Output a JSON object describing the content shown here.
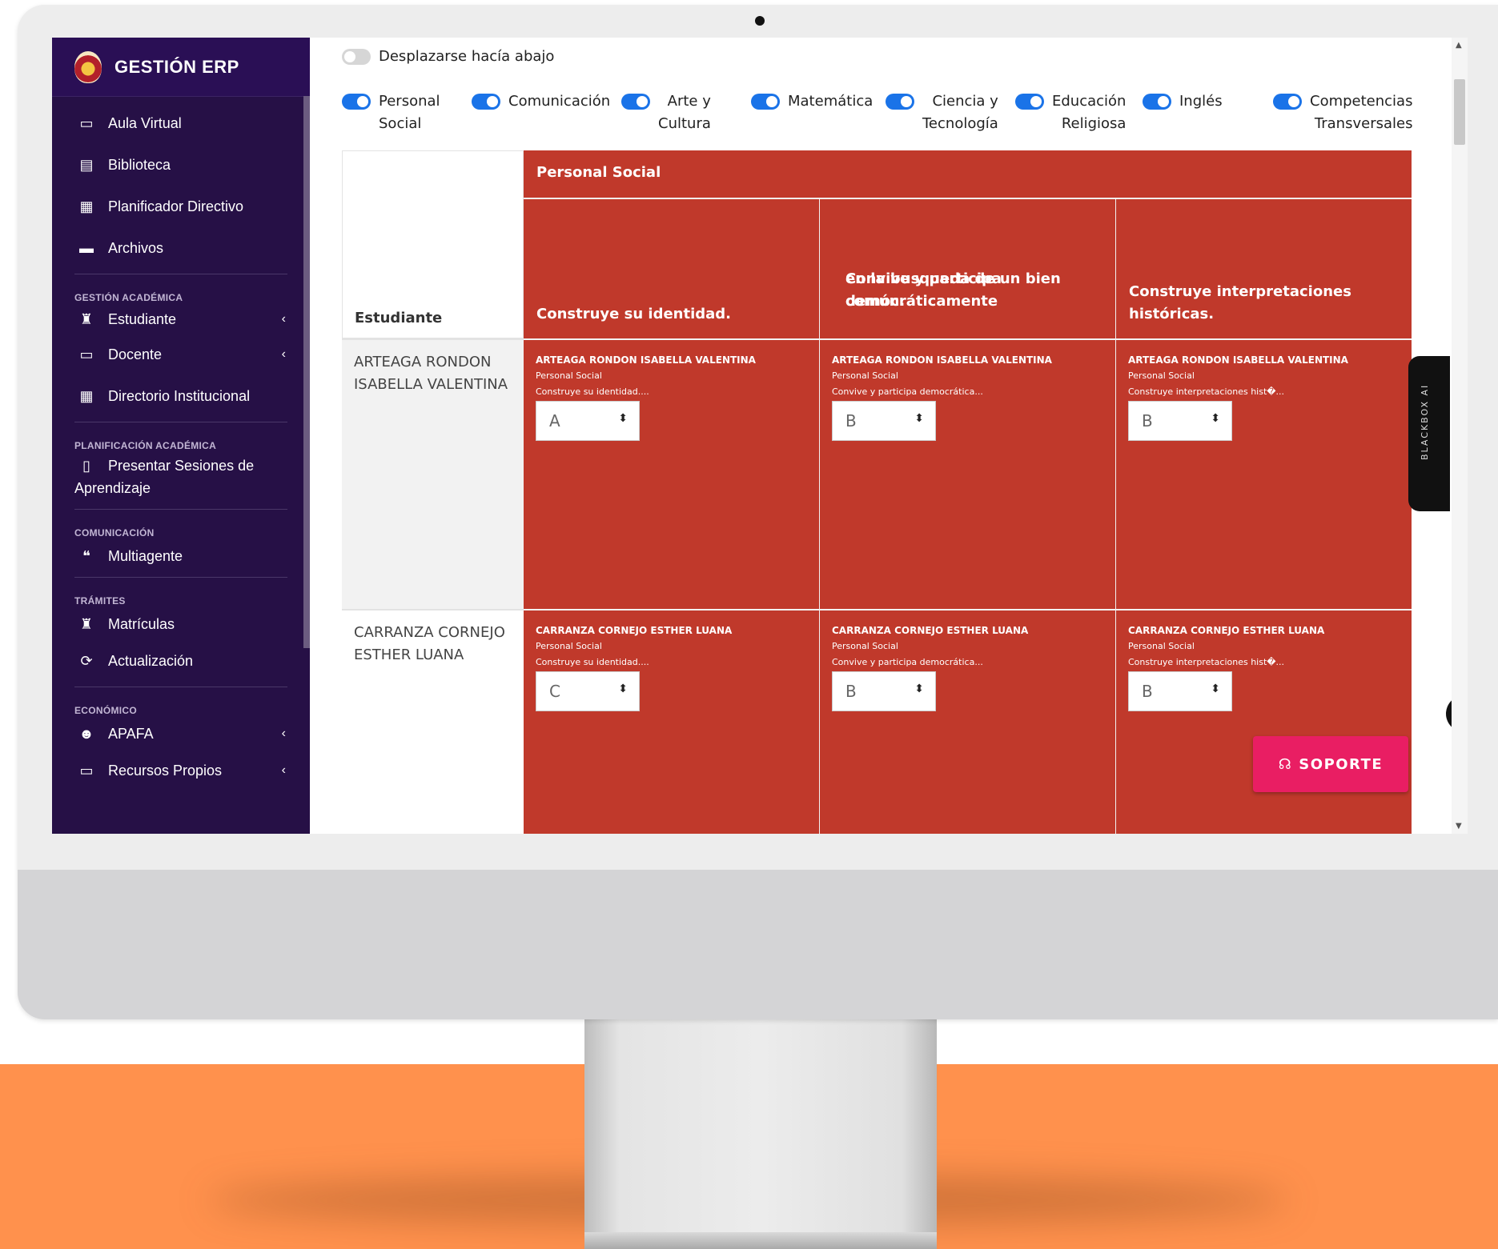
{
  "app": {
    "title": "GESTIÓN ERP"
  },
  "sidebar": {
    "items": [
      {
        "label": "Aula Virtual",
        "icon": "chalkboard-icon"
      },
      {
        "label": "Biblioteca",
        "icon": "book-icon"
      },
      {
        "label": "Planificador Directivo",
        "icon": "calendar-icon"
      },
      {
        "label": "Archivos",
        "icon": "drive-icon"
      }
    ],
    "sections": [
      {
        "title": "GESTIÓN ACADÉMICA",
        "items": [
          {
            "label": "Estudiante",
            "icon": "student-icon",
            "has_submenu": true
          },
          {
            "label": "Docente",
            "icon": "chalkboard-icon",
            "has_submenu": true
          },
          {
            "label": "Directorio Institucional",
            "icon": "calendar-icon"
          }
        ]
      },
      {
        "title": "PLANIFICACIÓN ACADÉMICA",
        "items": [
          {
            "label": "Presentar Sesiones de Aprendizaje",
            "icon": "file-icon"
          }
        ]
      },
      {
        "title": "COMUNICACIÓN",
        "items": [
          {
            "label": "Multiagente",
            "icon": "comments-icon"
          }
        ]
      },
      {
        "title": "TRÁMITES",
        "items": [
          {
            "label": "Matrículas",
            "icon": "student-icon"
          },
          {
            "label": "Actualización",
            "icon": "sync-icon"
          }
        ]
      },
      {
        "title": "ECONÓMICO",
        "items": [
          {
            "label": "APAFA",
            "icon": "users-icon",
            "has_submenu": true
          },
          {
            "label": "Recursos Propios",
            "icon": "money-icon",
            "has_submenu": true
          }
        ]
      }
    ]
  },
  "main": {
    "scroll_toggle": {
      "label": "Desplazarse hacía abajo",
      "on": false
    },
    "filters": [
      {
        "label_1": "Personal",
        "label_2": "Social",
        "on": true
      },
      {
        "label_1": "Comunicación",
        "label_2": "",
        "on": true
      },
      {
        "label_1": "Arte y",
        "label_2": "Cultura",
        "on": true
      },
      {
        "label_1": "Matemática",
        "label_2": "",
        "on": true
      },
      {
        "label_1": "Ciencia y",
        "label_2": "Tecnología",
        "on": true
      },
      {
        "label_1": "Educación",
        "label_2": "Religiosa",
        "on": true
      },
      {
        "label_1": "Inglés",
        "label_2": "",
        "on": true
      },
      {
        "label_1": "Competencias",
        "label_2": "Transversales",
        "on": true
      }
    ],
    "table": {
      "student_header": "Estudiante",
      "course": "Personal Social",
      "course_color": "#c0392b",
      "competencies": [
        {
          "title": "Construye su identidad.",
          "short": "Construye su identidad...."
        },
        {
          "title_1": "Convive y participa democráticamente",
          "title_2": "en la busqueda de un bien común.",
          "short": "Convive y participa democrática..."
        },
        {
          "title": "Construye interpretaciones históricas.",
          "short": "Construye interpretaciones hist�..."
        }
      ],
      "rows": [
        {
          "student": "ARTEAGA RONDON ISABELLA VALENTINA",
          "grades": [
            "A",
            "B",
            "B"
          ]
        },
        {
          "student": "CARRANZA CORNEJO ESTHER LUANA",
          "grades": [
            "C",
            "B",
            "B"
          ]
        }
      ]
    },
    "blackbox_label": "BLACKBOX AI",
    "support_label": "SOPORTE",
    "accent_toggle": "#1a73e8",
    "support_color": "#e91e63"
  }
}
